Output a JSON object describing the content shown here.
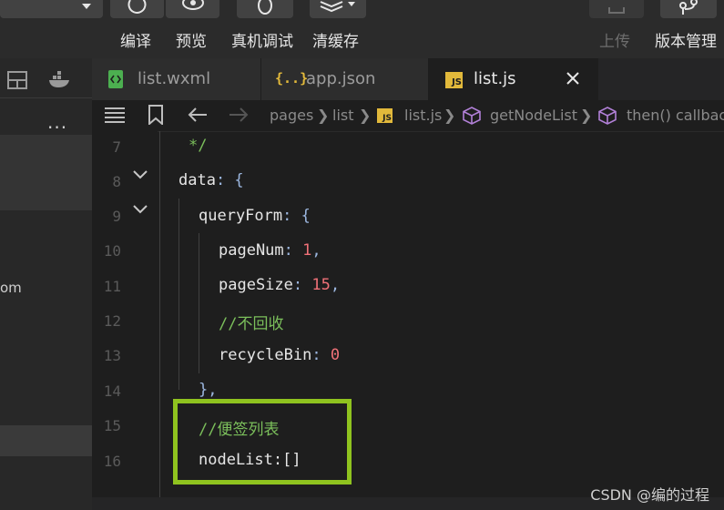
{
  "toolbar": {
    "labels": [
      "编译",
      "预览",
      "真机调试",
      "清缓存",
      "上传",
      "版本管理"
    ]
  },
  "tabs": [
    {
      "icon": "<>",
      "label": "list.wxml"
    },
    {
      "icon": "{..}",
      "label": "app.json"
    },
    {
      "icon": "JS",
      "label": "list.js"
    }
  ],
  "breadcrumb": {
    "items": [
      "pages",
      "list",
      "list.js",
      "getNodeList",
      "then() callback"
    ]
  },
  "left_panel": {
    "more": "...",
    "partial_text": "om"
  },
  "editor": {
    "line_numbers": [
      "7",
      "8",
      "9",
      "10",
      "11",
      "12",
      "13",
      "14",
      "15",
      "16"
    ],
    "lines": {
      "l7": "*/",
      "l8_key": "data",
      "l8_rest": ": {",
      "l9_key": "queryForm",
      "l9_rest": ": {",
      "l10_key": "pageNum",
      "l10_sep": ": ",
      "l10_val": "1",
      "l10_end": ",",
      "l11_key": "pageSize",
      "l11_sep": ": ",
      "l11_val": "15",
      "l11_end": ",",
      "l12": "//不回收",
      "l13_key": "recycleBin",
      "l13_sep": ": ",
      "l13_val": "0",
      "l14": "},",
      "l15": "//便签列表",
      "l16": "nodeList:[]"
    }
  },
  "watermark": "CSDN @编的过程",
  "colors": {
    "highlight_border": "#8fc31f",
    "comment": "#7bbf5b",
    "number": "#f07178"
  }
}
